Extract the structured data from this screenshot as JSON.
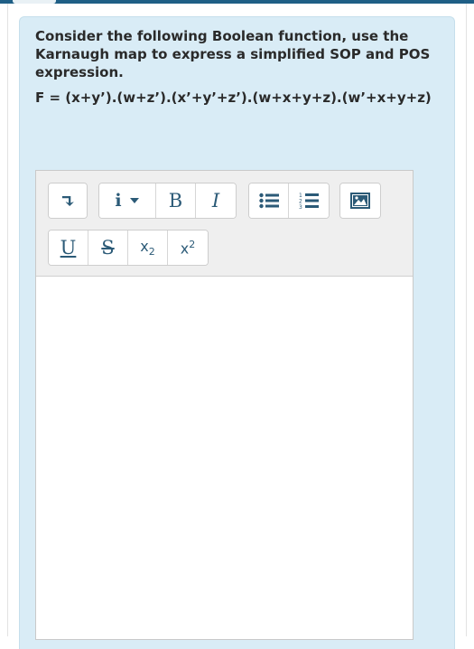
{
  "question": {
    "prompt": "Consider the following Boolean function, use the Karnaugh map to express a simplified SOP and POS expression.",
    "formula": "F = (x+y’).(w+z’).(x’+y’+z’).(w+x+y+z).(w’+x+y+z)"
  },
  "toolbar": {
    "row1": [
      {
        "name": "insert-arrow-icon",
        "glyph": "↴"
      },
      {
        "name": "info-dropdown",
        "glyph": "i"
      },
      {
        "name": "bold",
        "glyph": "B"
      },
      {
        "name": "italic",
        "glyph": "I"
      },
      {
        "name": "bullet-list-icon"
      },
      {
        "name": "numbered-list-icon",
        "numbers": [
          "1",
          "2",
          "3"
        ]
      },
      {
        "name": "image-icon"
      }
    ],
    "row2": [
      {
        "name": "underline",
        "glyph": "U"
      },
      {
        "name": "strikethrough",
        "glyph": "S"
      },
      {
        "name": "subscript",
        "base": "x",
        "mark": "2"
      },
      {
        "name": "superscript",
        "base": "x",
        "mark": "2"
      }
    ]
  },
  "colors": {
    "card_background": "#d9ecf6",
    "toolbar_icon": "#2b5a77",
    "top_bar": "#1f5f86"
  }
}
